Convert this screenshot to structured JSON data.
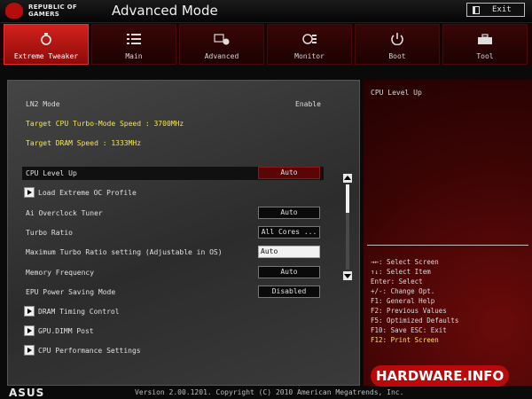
{
  "header": {
    "brand_line1": "REPUBLIC OF",
    "brand_line2": "GAMERS",
    "mode_title": "Advanced Mode",
    "exit_label": "Exit"
  },
  "tabs": [
    {
      "label": "Extreme Tweaker",
      "icon": "pocket-watch-icon",
      "active": true
    },
    {
      "label": "Main",
      "icon": "list-icon"
    },
    {
      "label": "Advanced",
      "icon": "chip-info-icon"
    },
    {
      "label": "Monitor",
      "icon": "monitor-gauge-icon"
    },
    {
      "label": "Boot",
      "icon": "power-icon"
    },
    {
      "label": "Tool",
      "icon": "toolbox-icon"
    }
  ],
  "info": {
    "ln2_label": "LN2 Mode",
    "ln2_value": "Enable",
    "target_cpu": "Target CPU Turbo-Mode Speed : 3700MHz",
    "target_dram": "Target DRAM Speed : 1333MHz"
  },
  "settings": [
    {
      "label": "CPU Level Up",
      "value": "Auto"
    },
    {
      "label": "Load Extreme OC Profile"
    },
    {
      "label": "Ai Overclock Tuner",
      "value": "Auto"
    },
    {
      "label": "Turbo Ratio",
      "value": "All Cores ..."
    },
    {
      "label": "Maximum Turbo Ratio setting (Adjustable in OS)",
      "value": "Auto"
    },
    {
      "label": "Memory Frequency",
      "value": "Auto"
    },
    {
      "label": "EPU Power Saving Mode",
      "value": "Disabled"
    },
    {
      "label": "DRAM Timing Control"
    },
    {
      "label": "GPU.DIMM Post"
    },
    {
      "label": "CPU Performance Settings"
    }
  ],
  "help": {
    "title": "CPU Level Up",
    "keys": [
      "→←: Select Screen",
      "↑↓: Select Item",
      "Enter: Select",
      "+/-: Change Opt.",
      "F1: General Help",
      "F2: Previous Values",
      "F5: Optimized Defaults",
      "F10: Save  ESC: Exit",
      "F12: Print Screen"
    ]
  },
  "watermark": "HARDWARE.INFO",
  "footer": {
    "logo": "ASUS",
    "copyright": "Version 2.00.1201. Copyright (C) 2010 American Megatrends, Inc."
  },
  "colors": {
    "accent_red": "#d4211c",
    "highlight_yellow": "#f5e84a"
  }
}
